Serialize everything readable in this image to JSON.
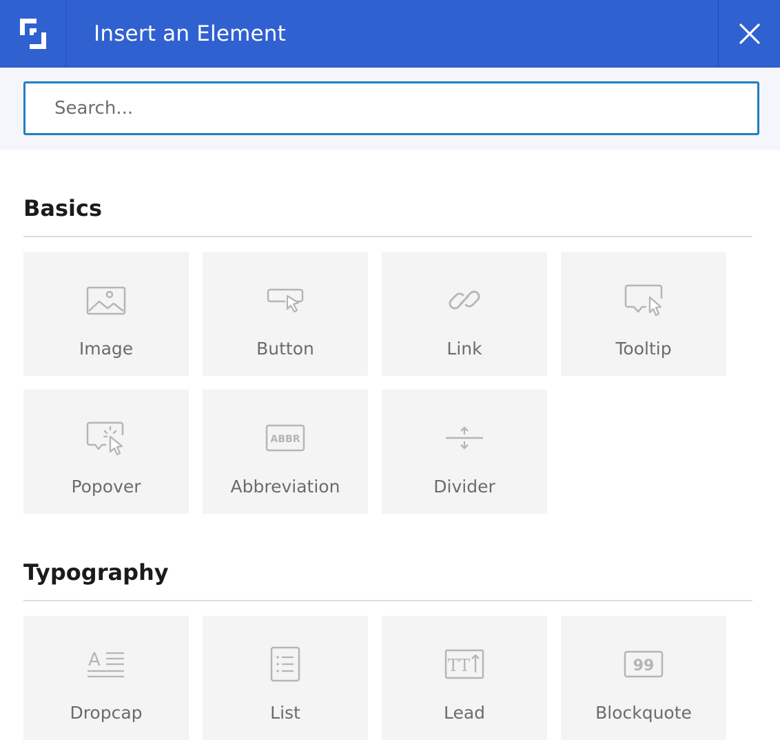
{
  "header": {
    "title": "Insert an Element",
    "brand_color": "#3061d1",
    "logo_icon": "brand-logo-icon",
    "close_icon": "close-icon"
  },
  "search": {
    "placeholder": "Search...",
    "value": ""
  },
  "sections": [
    {
      "title": "Basics",
      "items": [
        {
          "label": "Image",
          "icon": "image-icon"
        },
        {
          "label": "Button",
          "icon": "button-cursor-icon"
        },
        {
          "label": "Link",
          "icon": "link-icon"
        },
        {
          "label": "Tooltip",
          "icon": "tooltip-icon"
        },
        {
          "label": "Popover",
          "icon": "popover-icon"
        },
        {
          "label": "Abbreviation",
          "icon": "abbreviation-icon",
          "icon_text": "ABBR"
        },
        {
          "label": "Divider",
          "icon": "divider-icon"
        }
      ]
    },
    {
      "title": "Typography",
      "items": [
        {
          "label": "Dropcap",
          "icon": "dropcap-icon",
          "icon_text": "A"
        },
        {
          "label": "List",
          "icon": "list-icon"
        },
        {
          "label": "Lead",
          "icon": "lead-icon",
          "icon_text": "TT"
        },
        {
          "label": "Blockquote",
          "icon": "blockquote-icon",
          "icon_text": "99"
        }
      ]
    }
  ]
}
